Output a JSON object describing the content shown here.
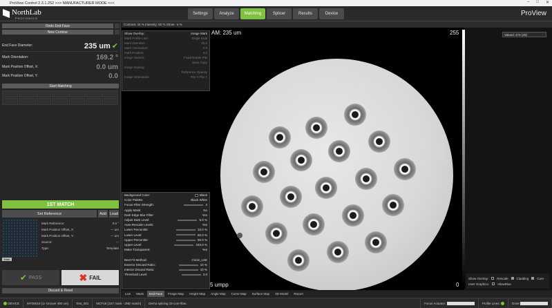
{
  "titlebar": {
    "title": "ProView Control 2.3.1.252 >>> MANUFACTURER MODE <<<"
  },
  "header": {
    "logo_name": "NorthLab",
    "logo_sub": "PHOTONICS",
    "tabs": [
      "Settings",
      "Analyze",
      "Matching",
      "Splicer",
      "Results",
      "Device"
    ],
    "active_tab": "Matching",
    "brand": "ProView"
  },
  "left": {
    "btn_redo": "Redo End Face",
    "btn_new_contour": "New Contour",
    "end_face_label": "End Face Diameter:",
    "end_face_value": "235 um",
    "mark_orient_label": "Mark Orientation:",
    "mark_orient_value": "169.2 °",
    "mark_x_label": "Mark Position Offset, X:",
    "mark_x_value": "0.0 um",
    "mark_y_label": "Mark Position Offset, Y:",
    "mark_y_value": "0.0",
    "start_matching": "Start Matching",
    "match_status": "1ST MATCH",
    "set_reference": "Set Reference",
    "add": "Add",
    "load": "Load",
    "ref_info": [
      {
        "label": "Mark Reference:",
        "value": "0.0 °"
      },
      {
        "label": "Mark Position Offset, X:",
        "value": "--- um"
      },
      {
        "label": "Mark Position Offset, Y:",
        "value": "--- um"
      },
      {
        "label": "Source:",
        "value": "---"
      },
      {
        "label": "Type:",
        "value": "Template"
      }
    ],
    "mark_chip": "Mark",
    "pass": "PASS",
    "fail": "FAIL",
    "discard": "Discard & Reset"
  },
  "viewer": {
    "info": "Contrast: 44 %   Intensity: 82 %   Show: -4 %",
    "diameter_text": "AM: 235 um",
    "scale_max": "255",
    "scale_min": "0",
    "scale_bottom": "5 umpp"
  },
  "overlay": {
    "rows": [
      {
        "label": "Show Overlay:",
        "value": "Image  Mark"
      },
      {
        "label": "Mark Profile Line:",
        "value": "Single  Dual"
      },
      {
        "label": "Mark Diameter:",
        "value": "35.0"
      },
      {
        "label": "Mark Orientation:",
        "value": "0.0"
      },
      {
        "label": "Mark Position:",
        "value": "0.0"
      },
      {
        "label": "Image Search:",
        "value": "Fixed  Rotate  Flip"
      },
      {
        "label": "",
        "value": "Save  Copy"
      },
      {
        "label": "Image Scaling:",
        "value": ""
      },
      {
        "label": "",
        "value": "Reference Opacity"
      },
      {
        "label": "Image Orientation:",
        "value": "Flip X  Flip Y"
      }
    ]
  },
  "settings": {
    "rows": [
      {
        "label": "Background Color:",
        "value": "Black"
      },
      {
        "label": "Color Palette:",
        "value": "Black White"
      },
      {
        "label": "Focus Filter Strength:",
        "value": "3"
      },
      {
        "label": "Apply Mask:",
        "value": "No"
      },
      {
        "label": "Dark Edge Blur Filter:",
        "value": "Yes"
      },
      {
        "label": "Adjust Dark Level:",
        "value": "5.0 %"
      },
      {
        "label": "Auto-Rescale Levels:",
        "value": "Yes"
      },
      {
        "label": "Lower Percentile:",
        "value": "10.0 %"
      },
      {
        "label": "Lower Level:",
        "value": "80.0 %"
      },
      {
        "label": "Upper Percentile:",
        "value": "90.0 %"
      },
      {
        "label": "Upper Level:",
        "value": "240.0 %"
      },
      {
        "label": "Make Transparent:",
        "value": "Yes"
      },
      {
        "label": "",
        "value": ""
      },
      {
        "label": "Best Fit Method:",
        "value": "Circle_LSE"
      },
      {
        "label": "Exterior Discard Ratio:",
        "value": "10 %"
      },
      {
        "label": "Interior Discard Ratio:",
        "value": "10 %"
      },
      {
        "label": "Threshold Level:",
        "value": "3.0"
      }
    ]
  },
  "right": {
    "value_select": "Valued: 474 (25)",
    "show_overlay": "Show Overlay:",
    "opt_rescale": "Rescale",
    "opt_cladding": "Cladding",
    "opt_core": "Core",
    "user_graphics": "User Graphics:",
    "opt_allowblue": "AllowBlue"
  },
  "maptabs": [
    "Live",
    "Mask",
    "End Face",
    "Fringe Map",
    "Height Map",
    "Angle Map",
    "Curve Map",
    "Surface Map",
    "3D Model",
    "Report"
  ],
  "active_maptab": "End Face",
  "status": {
    "device": "DEVICE",
    "fiber": "WT00019 (1r Groove 400 um)",
    "test": "Test_001",
    "mcf": "MCF19 (1ST mark - 2ND match)",
    "message": "Demo splicing 19 core fiber.",
    "focus": "Focus Actuator:",
    "profile": "Profile Lines:",
    "done": "Done"
  }
}
